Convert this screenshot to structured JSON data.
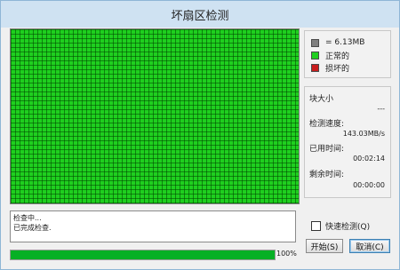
{
  "window": {
    "title": "坏扇区检测"
  },
  "legend": [
    {
      "label": "= 6.13MB",
      "color": "#7f7f7f"
    },
    {
      "label": "正常的",
      "color": "#1fcf1f"
    },
    {
      "label": "损坏的",
      "color": "#c81e1e"
    }
  ],
  "stats": {
    "block_size_label": "块大小",
    "block_size_value": "---",
    "speed_label": "检测速度:",
    "speed_value": "143.03MB/s",
    "elapsed_label": "已用时间:",
    "elapsed_value": "00:02:14",
    "remaining_label": "剩余时间:",
    "remaining_value": "00:00:00"
  },
  "log": {
    "lines": [
      "检查中...",
      "已完成检查."
    ]
  },
  "progress": {
    "percent_text": "100%",
    "value": 1.0
  },
  "options": {
    "quick_check_label": "快速检测(Q)",
    "quick_check_checked": false
  },
  "buttons": {
    "start_label": "开始(S)",
    "cancel_label": "取消(C)"
  }
}
